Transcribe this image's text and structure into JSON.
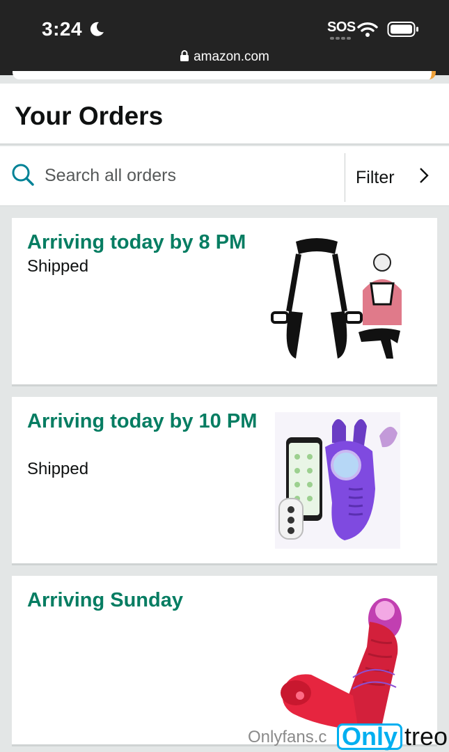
{
  "status_bar": {
    "time": "3:24",
    "carrier": "SOS",
    "url": "amazon.com"
  },
  "page": {
    "title": "Your Orders"
  },
  "search": {
    "placeholder": "Search all orders",
    "filter_label": "Filter"
  },
  "orders": [
    {
      "arrival": "Arriving today by 8 PM",
      "status": "Shipped",
      "image_icon": "harness-product-image"
    },
    {
      "arrival": "Arriving today by 10 PM",
      "status": "Shipped",
      "image_icon": "purple-device-product-image"
    },
    {
      "arrival": "Arriving Sunday",
      "status": "",
      "image_icon": "red-device-product-image"
    }
  ],
  "watermark": {
    "text": "Onlyfans.c",
    "logo_left": "Only",
    "logo_right": "treon"
  },
  "colors": {
    "status_bar": "#232323",
    "arrival_green": "#067d62",
    "search_icon": "#008296",
    "page_bg": "#e3e6e6"
  }
}
